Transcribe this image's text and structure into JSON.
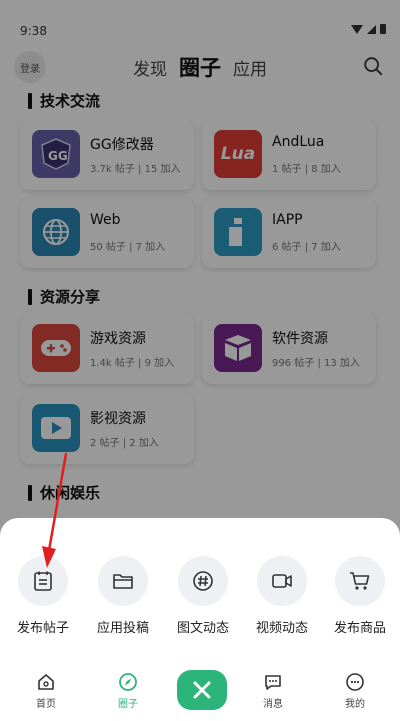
{
  "status_bar": {
    "time": "9:38"
  },
  "header": {
    "login_label": "登录",
    "tabs": [
      {
        "label": "发现"
      },
      {
        "label": "圈子"
      },
      {
        "label": "应用"
      }
    ]
  },
  "sections": [
    {
      "title": "技术交流",
      "cards": [
        {
          "name": "GG修改器",
          "meta": "3.7k 帖子 | 15 加入",
          "icon": "gg-icon",
          "color": "#6a5fa8"
        },
        {
          "name": "AndLua",
          "meta": "1 帖子 | 8 加入",
          "icon": "lua-icon",
          "color": "#e03c36",
          "icon_text": "Lua"
        },
        {
          "name": "Web",
          "meta": "50 帖子 | 7 加入",
          "icon": "globe-icon",
          "color": "#2b86b3"
        },
        {
          "name": "IAPP",
          "meta": "6 帖子 | 7 加入",
          "icon": "info-icon",
          "color": "#2f9bc5"
        }
      ]
    },
    {
      "title": "资源分享",
      "cards": [
        {
          "name": "游戏资源",
          "meta": "1.4k 帖子 | 9 加入",
          "icon": "gamepad-icon",
          "color": "#d9463c"
        },
        {
          "name": "软件资源",
          "meta": "996 帖子 | 13 加入",
          "icon": "box-icon",
          "color": "#7a2a8e"
        },
        {
          "name": "影视资源",
          "meta": "2 帖子 | 2 加入",
          "icon": "play-icon",
          "color": "#2a93bf"
        }
      ]
    },
    {
      "title": "休闲娱乐",
      "cards": []
    }
  ],
  "actions": [
    {
      "label": "发布帖子",
      "icon": "post-icon"
    },
    {
      "label": "应用投稿",
      "icon": "folder-icon"
    },
    {
      "label": "图文动态",
      "icon": "hashtag-icon"
    },
    {
      "label": "视频动态",
      "icon": "video-icon"
    },
    {
      "label": "发布商品",
      "icon": "cart-icon"
    }
  ],
  "bottom_nav": {
    "items": [
      {
        "label": "首页",
        "icon": "home-icon"
      },
      {
        "label": "圈子",
        "icon": "compass-icon"
      },
      {
        "label": "消息",
        "icon": "message-icon"
      },
      {
        "label": "我的",
        "icon": "profile-icon"
      }
    ],
    "close_icon": "close-icon"
  },
  "colors": {
    "accent": "#2bb57a",
    "annotation": "#e02020"
  }
}
